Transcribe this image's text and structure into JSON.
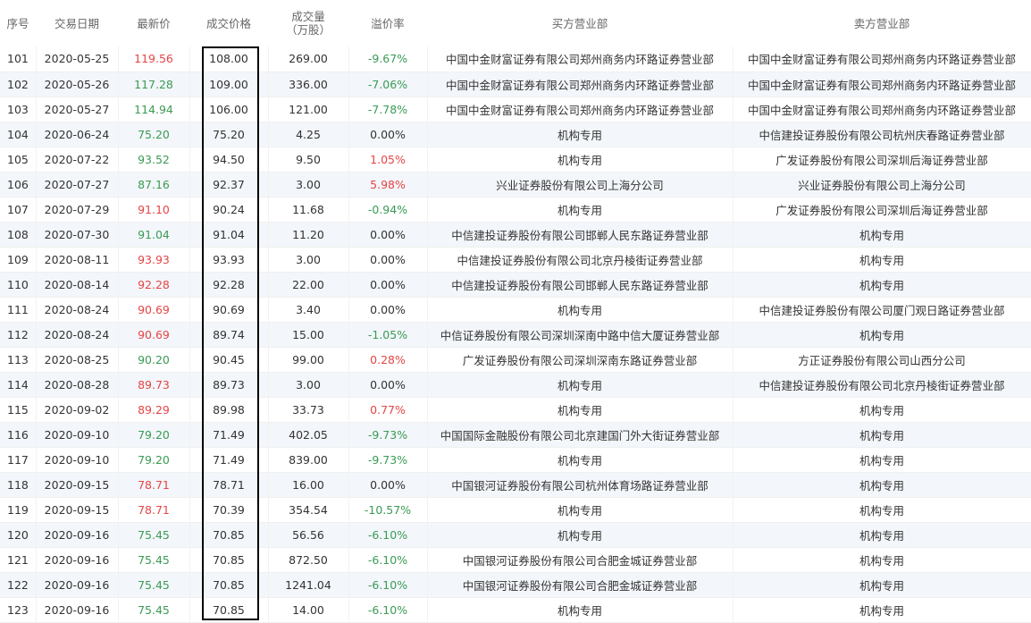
{
  "headers": {
    "seq": "序号",
    "date": "交易日期",
    "latest_price": "最新价",
    "deal_price": "成交价格",
    "volume_line1": "成交量",
    "volume_line2": "（万股）",
    "premium": "溢价率",
    "buyer": "买方营业部",
    "seller": "卖方营业部"
  },
  "colors": {
    "up": "#e64545",
    "down": "#3a9b55",
    "stripe": "#f3f6fa",
    "highlight_border": "#000000"
  },
  "rows": [
    {
      "seq": "101",
      "date": "2020-05-25",
      "latest": "119.56",
      "latest_dir": "up",
      "price": "108.00",
      "volume": "269.00",
      "premium": "-9.67%",
      "premium_dir": "down",
      "buyer": "中国中金财富证券有限公司郑州商务内环路证券营业部",
      "seller": "中国中金财富证券有限公司郑州商务内环路证券营业部"
    },
    {
      "seq": "102",
      "date": "2020-05-26",
      "latest": "117.28",
      "latest_dir": "down",
      "price": "109.00",
      "volume": "336.00",
      "premium": "-7.06%",
      "premium_dir": "down",
      "buyer": "中国中金财富证券有限公司郑州商务内环路证券营业部",
      "seller": "中国中金财富证券有限公司郑州商务内环路证券营业部"
    },
    {
      "seq": "103",
      "date": "2020-05-27",
      "latest": "114.94",
      "latest_dir": "down",
      "price": "106.00",
      "volume": "121.00",
      "premium": "-7.78%",
      "premium_dir": "down",
      "buyer": "中国中金财富证券有限公司郑州商务内环路证券营业部",
      "seller": "中国中金财富证券有限公司郑州商务内环路证券营业部"
    },
    {
      "seq": "104",
      "date": "2020-06-24",
      "latest": "75.20",
      "latest_dir": "down",
      "price": "75.20",
      "volume": "4.25",
      "premium": "0.00%",
      "premium_dir": "flat",
      "buyer": "机构专用",
      "seller": "中信建投证券股份有限公司杭州庆春路证券营业部"
    },
    {
      "seq": "105",
      "date": "2020-07-22",
      "latest": "93.52",
      "latest_dir": "down",
      "price": "94.50",
      "volume": "9.50",
      "premium": "1.05%",
      "premium_dir": "up",
      "buyer": "机构专用",
      "seller": "广发证券股份有限公司深圳后海证券营业部"
    },
    {
      "seq": "106",
      "date": "2020-07-27",
      "latest": "87.16",
      "latest_dir": "down",
      "price": "92.37",
      "volume": "3.00",
      "premium": "5.98%",
      "premium_dir": "up",
      "buyer": "兴业证券股份有限公司上海分公司",
      "seller": "兴业证券股份有限公司上海分公司"
    },
    {
      "seq": "107",
      "date": "2020-07-29",
      "latest": "91.10",
      "latest_dir": "up",
      "price": "90.24",
      "volume": "11.68",
      "premium": "-0.94%",
      "premium_dir": "down",
      "buyer": "机构专用",
      "seller": "广发证券股份有限公司深圳后海证券营业部"
    },
    {
      "seq": "108",
      "date": "2020-07-30",
      "latest": "91.04",
      "latest_dir": "down",
      "price": "91.04",
      "volume": "11.20",
      "premium": "0.00%",
      "premium_dir": "flat",
      "buyer": "中信建投证券股份有限公司邯郸人民东路证券营业部",
      "seller": "机构专用"
    },
    {
      "seq": "109",
      "date": "2020-08-11",
      "latest": "93.93",
      "latest_dir": "up",
      "price": "93.93",
      "volume": "3.00",
      "premium": "0.00%",
      "premium_dir": "flat",
      "buyer": "中信建投证券股份有限公司北京丹棱街证券营业部",
      "seller": "机构专用"
    },
    {
      "seq": "110",
      "date": "2020-08-14",
      "latest": "92.28",
      "latest_dir": "up",
      "price": "92.28",
      "volume": "22.00",
      "premium": "0.00%",
      "premium_dir": "flat",
      "buyer": "中信建投证券股份有限公司邯郸人民东路证券营业部",
      "seller": "机构专用"
    },
    {
      "seq": "111",
      "date": "2020-08-24",
      "latest": "90.69",
      "latest_dir": "up",
      "price": "90.69",
      "volume": "3.40",
      "premium": "0.00%",
      "premium_dir": "flat",
      "buyer": "机构专用",
      "seller": "中信建投证券股份有限公司厦门观日路证券营业部"
    },
    {
      "seq": "112",
      "date": "2020-08-24",
      "latest": "90.69",
      "latest_dir": "up",
      "price": "89.74",
      "volume": "15.00",
      "premium": "-1.05%",
      "premium_dir": "down",
      "buyer": "中信证券股份有限公司深圳深南中路中信大厦证券营业部",
      "seller": "机构专用"
    },
    {
      "seq": "113",
      "date": "2020-08-25",
      "latest": "90.20",
      "latest_dir": "down",
      "price": "90.45",
      "volume": "99.00",
      "premium": "0.28%",
      "premium_dir": "up",
      "buyer": "广发证券股份有限公司深圳深南东路证券营业部",
      "seller": "方正证券股份有限公司山西分公司"
    },
    {
      "seq": "114",
      "date": "2020-08-28",
      "latest": "89.73",
      "latest_dir": "up",
      "price": "89.73",
      "volume": "3.00",
      "premium": "0.00%",
      "premium_dir": "flat",
      "buyer": "机构专用",
      "seller": "中信建投证券股份有限公司北京丹棱街证券营业部"
    },
    {
      "seq": "115",
      "date": "2020-09-02",
      "latest": "89.29",
      "latest_dir": "up",
      "price": "89.98",
      "volume": "33.73",
      "premium": "0.77%",
      "premium_dir": "up",
      "buyer": "机构专用",
      "seller": "机构专用"
    },
    {
      "seq": "116",
      "date": "2020-09-10",
      "latest": "79.20",
      "latest_dir": "down",
      "price": "71.49",
      "volume": "402.05",
      "premium": "-9.73%",
      "premium_dir": "down",
      "buyer": "中国国际金融股份有限公司北京建国门外大街证券营业部",
      "seller": "机构专用"
    },
    {
      "seq": "117",
      "date": "2020-09-10",
      "latest": "79.20",
      "latest_dir": "down",
      "price": "71.49",
      "volume": "839.00",
      "premium": "-9.73%",
      "premium_dir": "down",
      "buyer": "机构专用",
      "seller": "机构专用"
    },
    {
      "seq": "118",
      "date": "2020-09-15",
      "latest": "78.71",
      "latest_dir": "up",
      "price": "78.71",
      "volume": "16.00",
      "premium": "0.00%",
      "premium_dir": "flat",
      "buyer": "中国银河证券股份有限公司杭州体育场路证券营业部",
      "seller": "机构专用"
    },
    {
      "seq": "119",
      "date": "2020-09-15",
      "latest": "78.71",
      "latest_dir": "up",
      "price": "70.39",
      "volume": "354.54",
      "premium": "-10.57%",
      "premium_dir": "down",
      "buyer": "机构专用",
      "seller": "机构专用"
    },
    {
      "seq": "120",
      "date": "2020-09-16",
      "latest": "75.45",
      "latest_dir": "down",
      "price": "70.85",
      "volume": "56.56",
      "premium": "-6.10%",
      "premium_dir": "down",
      "buyer": "机构专用",
      "seller": "机构专用"
    },
    {
      "seq": "121",
      "date": "2020-09-16",
      "latest": "75.45",
      "latest_dir": "down",
      "price": "70.85",
      "volume": "872.50",
      "premium": "-6.10%",
      "premium_dir": "down",
      "buyer": "中国银河证券股份有限公司合肥金城证券营业部",
      "seller": "机构专用"
    },
    {
      "seq": "122",
      "date": "2020-09-16",
      "latest": "75.45",
      "latest_dir": "down",
      "price": "70.85",
      "volume": "1241.04",
      "premium": "-6.10%",
      "premium_dir": "down",
      "buyer": "中国银河证券股份有限公司合肥金城证券营业部",
      "seller": "机构专用"
    },
    {
      "seq": "123",
      "date": "2020-09-16",
      "latest": "75.45",
      "latest_dir": "down",
      "price": "70.85",
      "volume": "14.00",
      "premium": "-6.10%",
      "premium_dir": "down",
      "buyer": "机构专用",
      "seller": "机构专用"
    }
  ]
}
